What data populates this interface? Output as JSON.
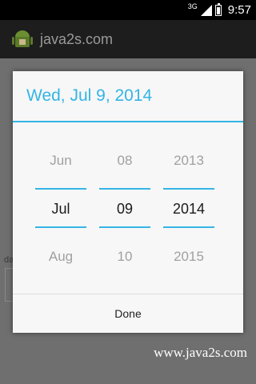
{
  "status_bar": {
    "network": "3G",
    "time": "9:57"
  },
  "app_bar": {
    "title": "java2s.com",
    "icon": "android-icon"
  },
  "background": {
    "label_fragment": "da"
  },
  "dialog": {
    "title": "Wed, Jul 9, 2014",
    "columns": [
      {
        "name": "month",
        "prev": "Jun",
        "current": "Jul",
        "next": "Aug"
      },
      {
        "name": "day",
        "prev": "08",
        "current": "09",
        "next": "10"
      },
      {
        "name": "year",
        "prev": "2013",
        "current": "2014",
        "next": "2015"
      }
    ],
    "done_label": "Done",
    "accent_color": "#33b5e5"
  },
  "watermark": "www.java2s.com"
}
